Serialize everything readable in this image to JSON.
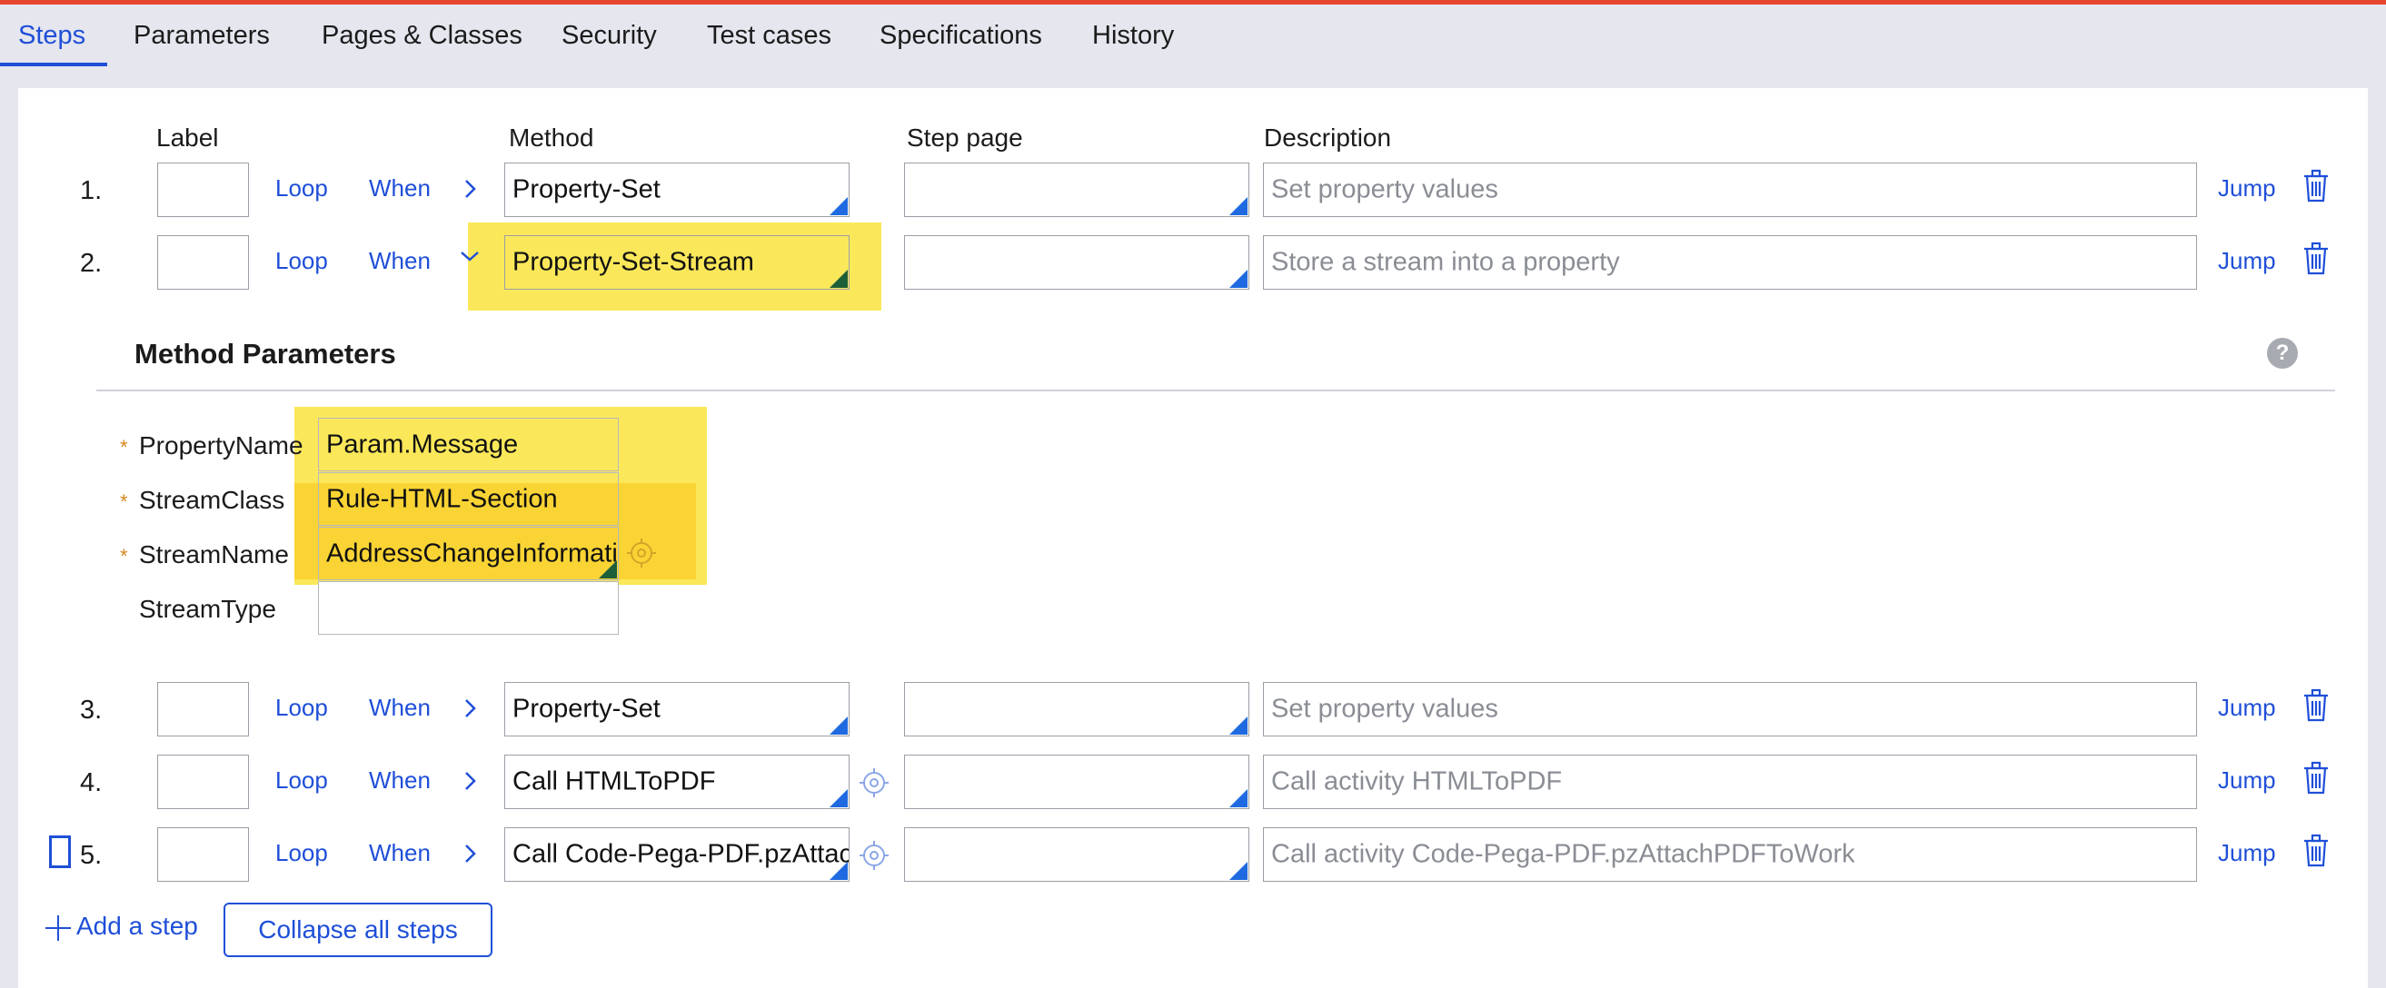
{
  "tabs": [
    "Steps",
    "Parameters",
    "Pages & Classes",
    "Security",
    "Test cases",
    "Specifications",
    "History"
  ],
  "columns": {
    "label": "Label",
    "method": "Method",
    "step_page": "Step page",
    "description": "Description"
  },
  "row_links": {
    "loop": "Loop",
    "when": "When",
    "jump": "Jump"
  },
  "steps": [
    {
      "num": "1.",
      "method": "Property-Set",
      "description": "Set property values"
    },
    {
      "num": "2.",
      "method": "Property-Set-Stream",
      "description": "Store a stream into a property"
    },
    {
      "num": "3.",
      "method": "Property-Set",
      "description": "Set property values"
    },
    {
      "num": "4.",
      "method": "Call HTMLToPDF",
      "description": "Call activity HTMLToPDF"
    },
    {
      "num": "5.",
      "method": "Call Code-Pega-PDF.pzAttachPDFToWork",
      "description": "Call activity Code-Pega-PDF.pzAttachPDFToWork"
    }
  ],
  "method_parameters": {
    "title": "Method Parameters",
    "help": "?",
    "required_marker": "*",
    "params": [
      {
        "label": "PropertyName",
        "value": "Param.Message"
      },
      {
        "label": "StreamClass",
        "value": "Rule-HTML-Section"
      },
      {
        "label": "StreamName",
        "value": "AddressChangeInformation"
      },
      {
        "label": "StreamType",
        "value": ""
      }
    ]
  },
  "footer": {
    "add_step": "Add a step",
    "collapse": "Collapse all steps"
  },
  "colors": {
    "accent": "#1f4fd8",
    "highlight": "#fbe85a",
    "topbar": "#e8452e"
  }
}
